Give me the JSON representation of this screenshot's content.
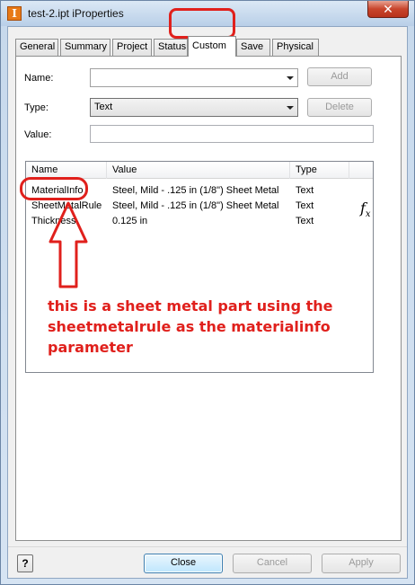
{
  "window": {
    "title": "test-2.ipt iProperties",
    "app_icon_letter": "I",
    "close_glyph": "✕"
  },
  "tabs": [
    {
      "label": "General"
    },
    {
      "label": "Summary"
    },
    {
      "label": "Project"
    },
    {
      "label": "Status"
    },
    {
      "label": "Custom",
      "active": true
    },
    {
      "label": "Save"
    },
    {
      "label": "Physical"
    }
  ],
  "form": {
    "name_label": "Name:",
    "name_value": "",
    "type_label": "Type:",
    "type_value": "Text",
    "value_label": "Value:",
    "value_value": "",
    "add_label": "Add",
    "delete_label": "Delete"
  },
  "grid": {
    "columns": [
      "Name",
      "Value",
      "Type"
    ],
    "rows": [
      {
        "name": "MaterialInfo",
        "value": "Steel, Mild - .125 in (1/8\") Sheet Metal",
        "type": "Text"
      },
      {
        "name": "SheetMetalRule",
        "value": "Steel, Mild - .125 in (1/8\") Sheet Metal",
        "type": "Text"
      },
      {
        "name": "Thickness",
        "value": "0.125 in",
        "type": "Text"
      }
    ],
    "fx_icon": "f",
    "fx_sub": "x"
  },
  "annotation": {
    "text": "this is a sheet metal part using the sheetmetalrule as the materialinfo parameter",
    "color": "#e0201c"
  },
  "footer": {
    "help_label": "?",
    "close_label": "Close",
    "cancel_label": "Cancel",
    "apply_label": "Apply"
  }
}
